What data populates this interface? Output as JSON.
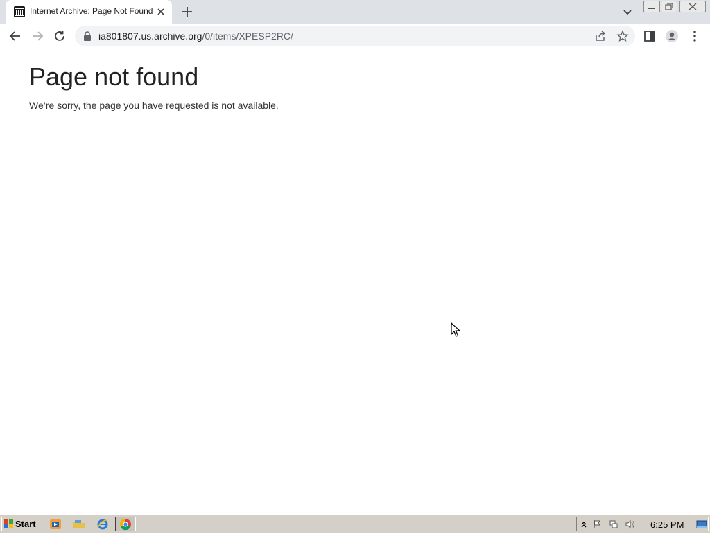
{
  "browser": {
    "tab": {
      "title": "Internet Archive: Page Not Found",
      "favicon": "internet-archive-icon"
    },
    "address": {
      "host": "ia801807.us.archive.org",
      "path": "/0/items/XPESP2RC/"
    }
  },
  "page": {
    "heading": "Page not found",
    "message": "We’re sorry, the page you have requested is not available."
  },
  "taskbar": {
    "start_label": "Start",
    "clock": "6:25 PM"
  },
  "colors": {
    "tabstrip": "#dee1e6",
    "omnibox": "#f1f3f4",
    "taskbar": "#d4d0c8"
  }
}
